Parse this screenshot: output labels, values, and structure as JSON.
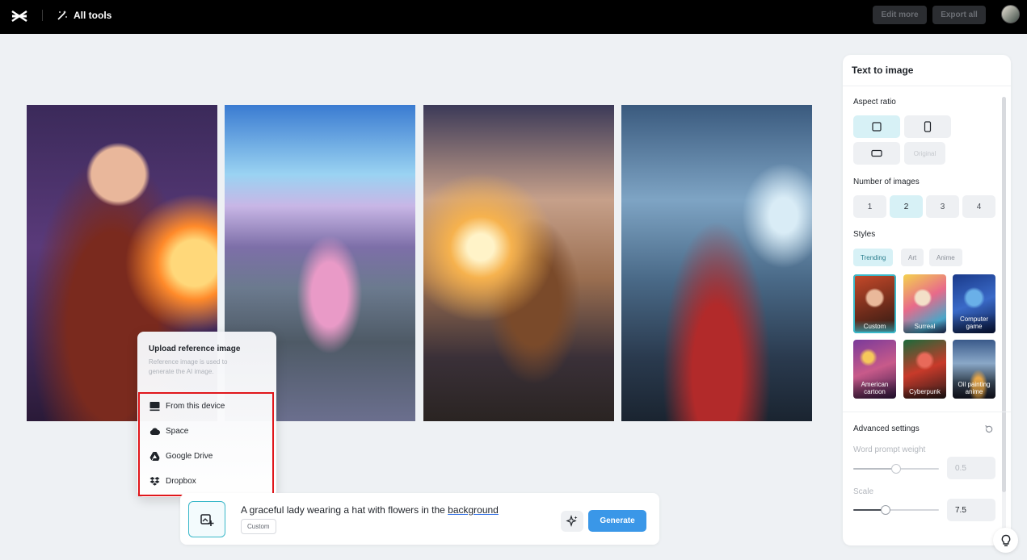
{
  "topbar": {
    "all_tools_label": "All tools",
    "edit_more_label": "Edit more",
    "export_all_label": "Export all"
  },
  "gallery": {
    "images": [
      {
        "description_icon": "fantasy-warrior-woman-image"
      },
      {
        "description_icon": "castle-pink-car-image"
      },
      {
        "description_icon": "cat-mountain-sunset-image"
      },
      {
        "description_icon": "mountain-pagoda-image"
      }
    ]
  },
  "upload_popup": {
    "title": "Upload reference image",
    "description": "Reference image is used to generate the AI image.",
    "options": [
      {
        "label": "From this device",
        "icon": "device-icon"
      },
      {
        "label": "Space",
        "icon": "cloud-icon"
      },
      {
        "label": "Google Drive",
        "icon": "google-drive-icon"
      },
      {
        "label": "Dropbox",
        "icon": "dropbox-icon"
      }
    ]
  },
  "prompt": {
    "text_before": "A graceful lady wearing a hat with flowers in the ",
    "text_underlined": "background",
    "style_tag": "Custom",
    "generate_label": "Generate"
  },
  "panel": {
    "title": "Text to image",
    "aspect_ratio_label": "Aspect ratio",
    "aspect_original_label": "Original",
    "number_of_images_label": "Number of images",
    "numbers": [
      "1",
      "2",
      "3",
      "4"
    ],
    "selected_number": "2",
    "styles_label": "Styles",
    "style_tabs": [
      "Trending",
      "Art",
      "Anime"
    ],
    "styles": [
      {
        "label": "Custom"
      },
      {
        "label": "Surreal"
      },
      {
        "label": "Computer game"
      },
      {
        "label": "American cartoon"
      },
      {
        "label": "Cyberpunk"
      },
      {
        "label": "Oil painting anime"
      }
    ],
    "advanced_label": "Advanced settings",
    "word_prompt_weight_label": "Word prompt weight",
    "word_prompt_weight_value": "0.5",
    "scale_label": "Scale",
    "scale_value": "7.5"
  },
  "colors": {
    "accent": "#3ab8c9",
    "generate": "#3a97e8",
    "highlight_border": "#e0161b"
  }
}
